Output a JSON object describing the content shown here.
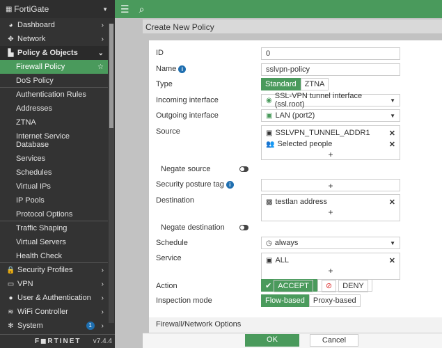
{
  "app": {
    "title": "FortiGate",
    "version": "v7.4.4",
    "logo": "FURTINET"
  },
  "sidebar": {
    "items": [
      {
        "label": "Dashboard",
        "icon": "dashboard-icon",
        "type": "section"
      },
      {
        "label": "Network",
        "icon": "network-icon",
        "type": "section"
      },
      {
        "label": "Policy & Objects",
        "icon": "policy-icon",
        "type": "open"
      },
      {
        "label": "Firewall Policy",
        "type": "active"
      },
      {
        "label": "DoS Policy",
        "type": "sub"
      },
      {
        "label": "Authentication Rules",
        "type": "sub"
      },
      {
        "label": "Addresses",
        "type": "sub"
      },
      {
        "label": "ZTNA",
        "type": "sub"
      },
      {
        "label": "Internet Service Database",
        "type": "sub"
      },
      {
        "label": "Services",
        "type": "sub"
      },
      {
        "label": "Schedules",
        "type": "sub"
      },
      {
        "label": "Virtual IPs",
        "type": "sub"
      },
      {
        "label": "IP Pools",
        "type": "sub"
      },
      {
        "label": "Protocol Options",
        "type": "sub"
      },
      {
        "label": "Traffic Shaping",
        "type": "sub"
      },
      {
        "label": "Virtual Servers",
        "type": "sub"
      },
      {
        "label": "Health Check",
        "type": "sub"
      },
      {
        "label": "Security Profiles",
        "icon": "lock-icon",
        "type": "section"
      },
      {
        "label": "VPN",
        "icon": "laptop-icon",
        "type": "section"
      },
      {
        "label": "User & Authentication",
        "icon": "user-icon",
        "type": "section"
      },
      {
        "label": "WiFi Controller",
        "icon": "wifi-icon",
        "type": "section"
      },
      {
        "label": "System",
        "icon": "gear-icon",
        "type": "section",
        "badge": "1"
      }
    ]
  },
  "modal": {
    "title": "Create New Policy",
    "labels": {
      "id": "ID",
      "name": "Name",
      "type": "Type",
      "incoming": "Incoming interface",
      "outgoing": "Outgoing interface",
      "source": "Source",
      "negate_source": "Negate source",
      "posture": "Security posture tag",
      "destination": "Destination",
      "negate_destination": "Negate destination",
      "schedule": "Schedule",
      "service": "Service",
      "action": "Action",
      "inspection": "Inspection mode"
    },
    "values": {
      "id": "0",
      "name": "sslvpn-policy",
      "incoming": "SSL-VPN tunnel interface (ssl.root)",
      "outgoing": "LAN (port2)",
      "source": [
        "SSLVPN_TUNNEL_ADDR1",
        "Selected people"
      ],
      "destination": [
        "testlan address"
      ],
      "schedule": "always",
      "service": [
        "ALL"
      ]
    },
    "type_options": [
      "Standard",
      "ZTNA"
    ],
    "type_selected": "Standard",
    "action_options": [
      "ACCEPT",
      "DENY"
    ],
    "action_selected": "ACCEPT",
    "inspection_options": [
      "Flow-based",
      "Proxy-based"
    ],
    "inspection_selected": "Flow-based",
    "negate_source": false,
    "negate_destination": false,
    "section": "Firewall/Network Options",
    "ok": "OK",
    "cancel": "Cancel"
  },
  "colors": {
    "accent": "#4a9a5c",
    "info": "#1f6fb0",
    "sidebar": "#333333"
  }
}
